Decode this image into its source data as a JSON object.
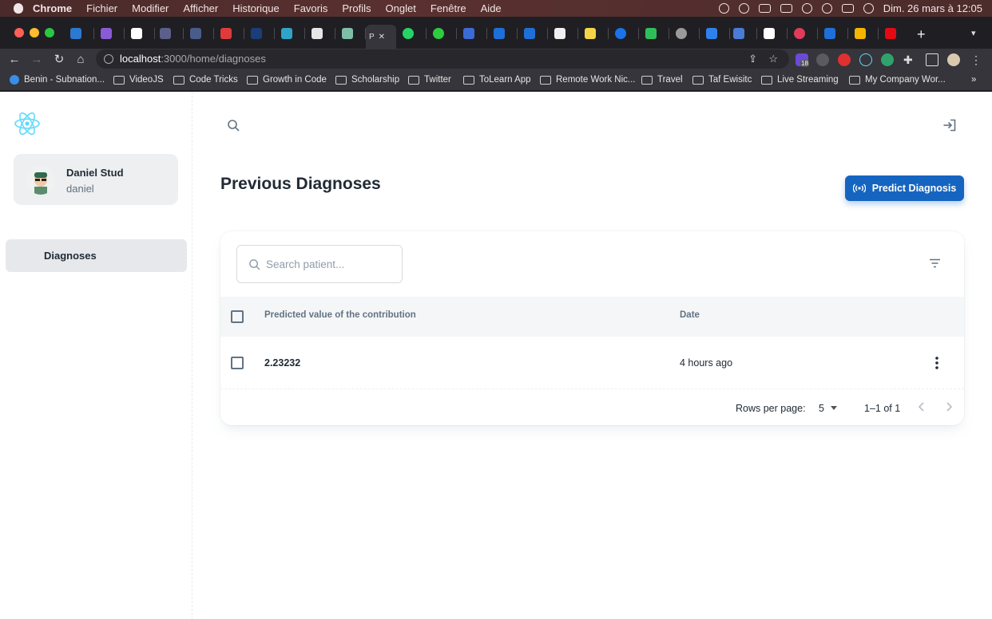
{
  "os_menubar": {
    "app": "Chrome",
    "menus": [
      "Fichier",
      "Modifier",
      "Afficher",
      "Historique",
      "Favoris",
      "Profils",
      "Onglet",
      "Fenêtre",
      "Aide"
    ],
    "clock": "Dim. 26 mars à 12:05"
  },
  "browser": {
    "active_tab_label": "P",
    "url_host": "localhost",
    "url_path": ":3000/home/diagnoses",
    "extension_badge": "18",
    "bookmarks": [
      "Benin - Subnation...",
      "VideoJS",
      "Code Tricks",
      "Growth in Code",
      "Scholarship",
      "Twitter",
      "ToLearn App",
      "Remote Work Nic...",
      "Travel",
      "Taf Ewisitc",
      "Live Streaming",
      "My Company Wor..."
    ]
  },
  "sidebar": {
    "account_name": "Daniel Stud",
    "account_username": "daniel",
    "nav_items": [
      {
        "label": "Diagnoses",
        "active": true
      }
    ]
  },
  "page": {
    "title": "Previous Diagnoses",
    "predict_button_label": "Predict Diagnosis",
    "search_placeholder": "Search patient..."
  },
  "table": {
    "columns": [
      "Predicted value of the contribution",
      "Date"
    ],
    "rows": [
      {
        "predicted_value": "2.23232",
        "date": "4 hours ago"
      }
    ]
  },
  "pagination": {
    "rows_per_page_label": "Rows per page:",
    "rows_per_page": "5",
    "range": "1–1 of 1"
  },
  "colors": {
    "primary": "#1565c0",
    "sidebar_active": "#e6e8eb",
    "react_logo": "#61dafb"
  }
}
